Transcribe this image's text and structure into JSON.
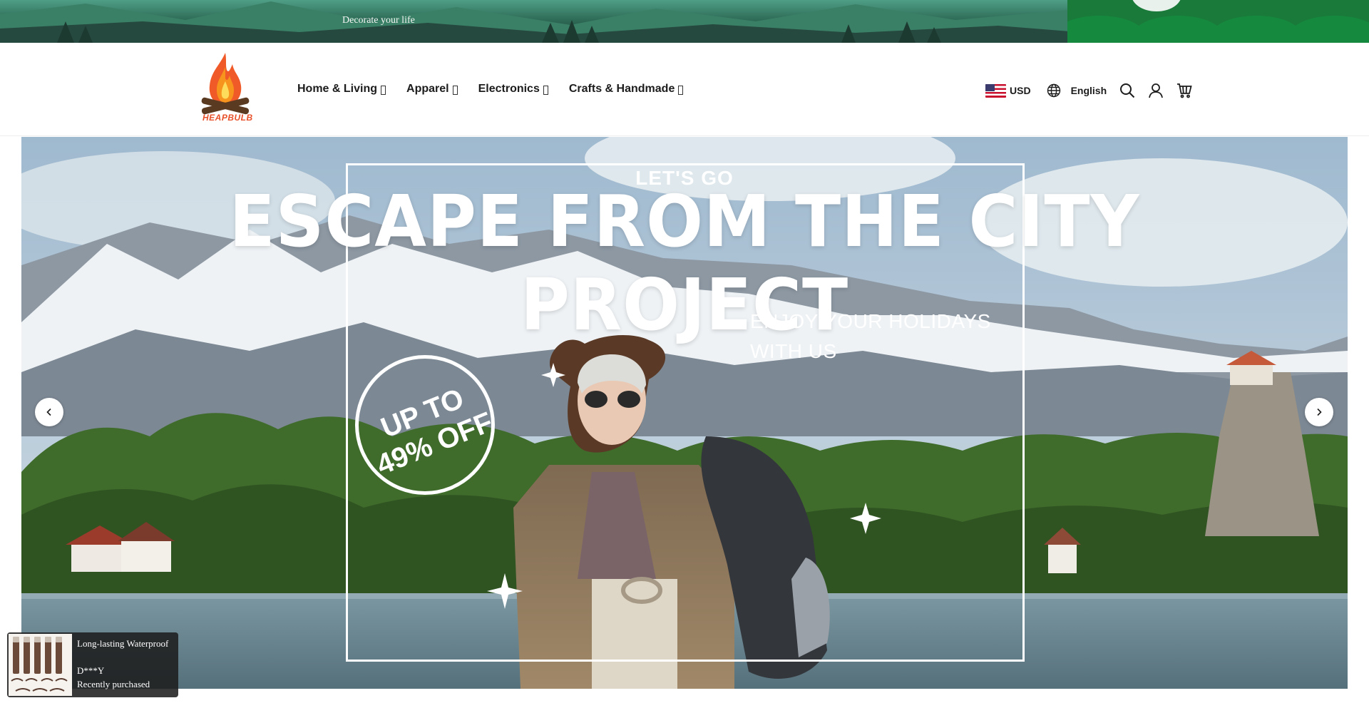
{
  "announcement": {
    "text": "Decorate your life"
  },
  "brand": {
    "name": "HEAPBULB",
    "color": "#e8502a"
  },
  "nav": {
    "items": [
      {
        "label": "Home & Living"
      },
      {
        "label": "Apparel"
      },
      {
        "label": "Electronics"
      },
      {
        "label": "Crafts & Handmade"
      }
    ]
  },
  "header": {
    "currency": "USD",
    "language": "English",
    "icons": [
      "us-flag-icon",
      "globe-icon",
      "search-icon",
      "account-icon",
      "cart-icon"
    ]
  },
  "hero": {
    "kicker": "LET'S GO",
    "headline": "ESCAPE FROM THE CITY PROJECT",
    "subline_1": "ENJOY YOUR HOLIDAYS",
    "subline_2": "WITH US",
    "badge_line_1": "UP TO",
    "badge_line_2": "49% OFF"
  },
  "popup": {
    "title": "Long-lasting Waterproof",
    "buyer": "D***Y",
    "status": "Recently purchased"
  }
}
